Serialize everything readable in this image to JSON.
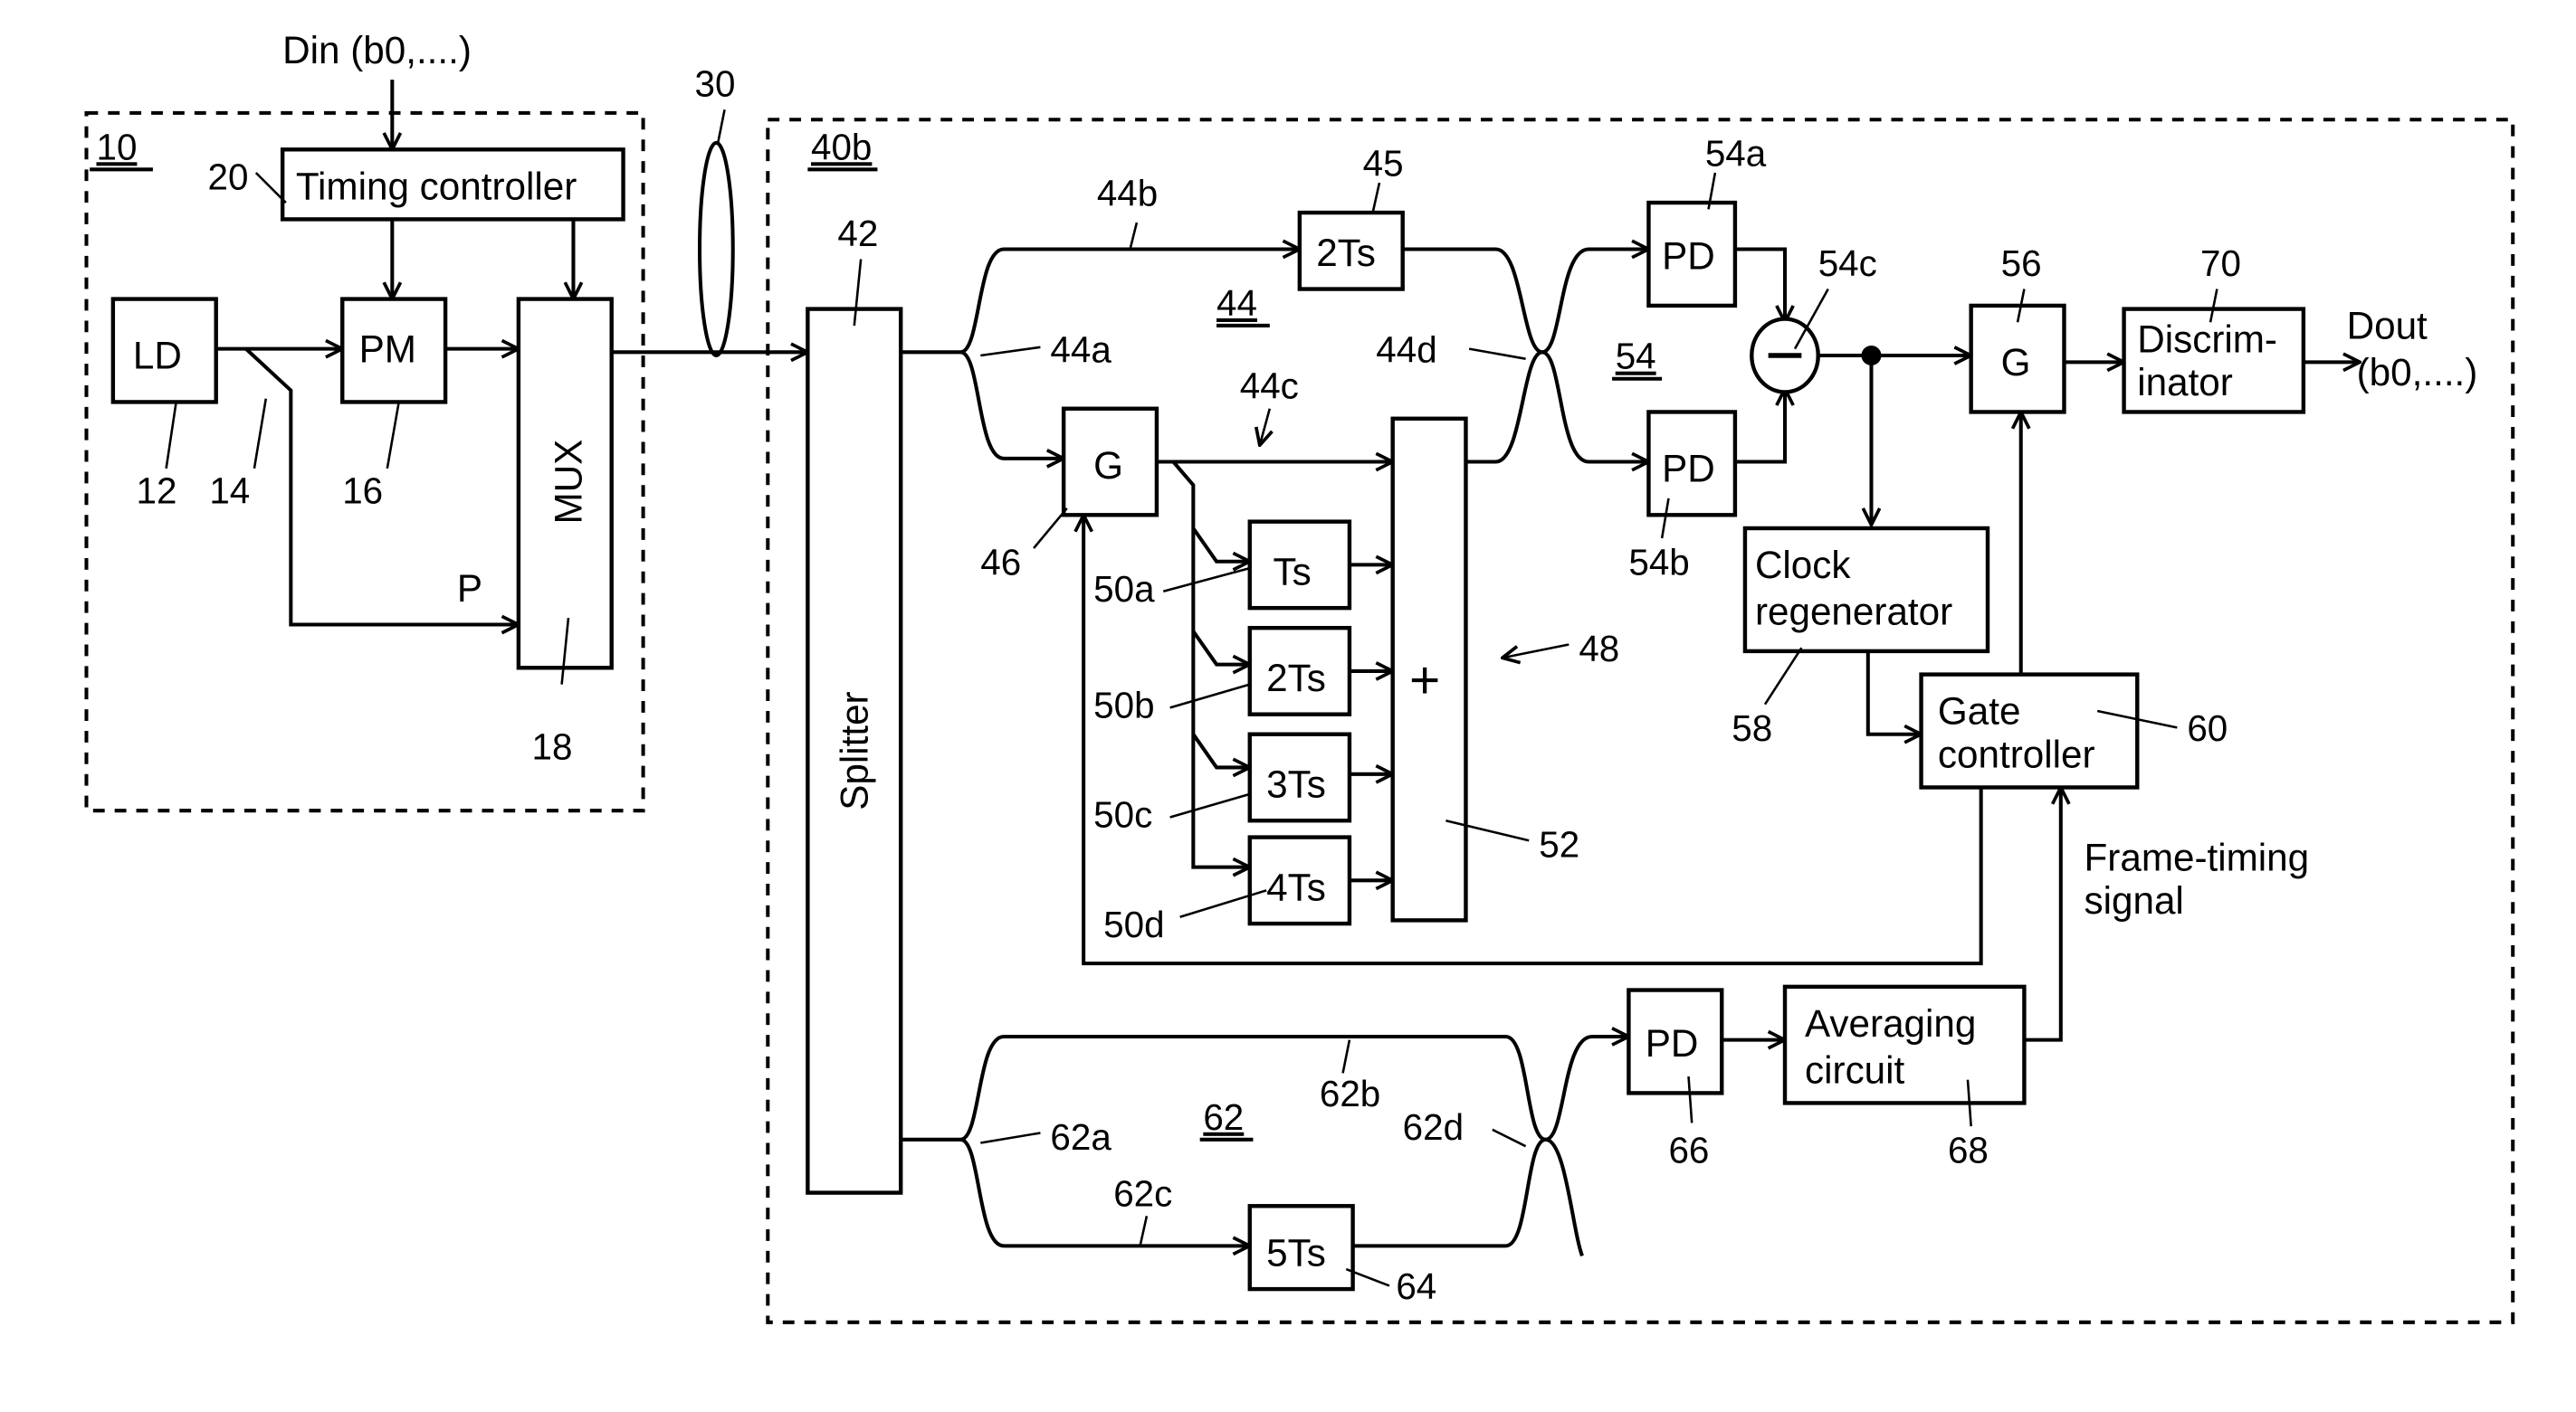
{
  "input_label": "Din (b0,....)",
  "output_label_line1": "Dout",
  "output_label_line2": "(b0,....)",
  "transmitter": {
    "ref": "10",
    "timing_controller": {
      "label": "Timing controller",
      "ref": "20"
    },
    "laser": {
      "label": "LD",
      "ref": "12"
    },
    "branch_ref": "14",
    "phase_modulator": {
      "label": "PM",
      "ref": "16"
    },
    "mux": {
      "label": "MUX",
      "ref": "18"
    },
    "pulse_label": "P"
  },
  "fiber_ref": "30",
  "receiver": {
    "ref": "40b",
    "splitter": {
      "label": "Splitter",
      "ref": "42"
    },
    "interferometer_44": {
      "ref": "44",
      "arm_refs": [
        "44a",
        "44b",
        "44c",
        "44d"
      ],
      "delay": {
        "label": "2Ts",
        "ref": "45"
      }
    },
    "gate_46": {
      "label": "G",
      "ref": "46"
    },
    "delay_bank": {
      "ref": "48",
      "delays": [
        {
          "label": "Ts",
          "ref": "50a"
        },
        {
          "label": "2Ts",
          "ref": "50b"
        },
        {
          "label": "3Ts",
          "ref": "50c"
        },
        {
          "label": "4Ts",
          "ref": "50d"
        }
      ],
      "combiner": {
        "label": "+",
        "ref": "52"
      }
    },
    "balanced_detector": {
      "ref": "54",
      "pd_top": {
        "label": "PD",
        "ref": "54a"
      },
      "pd_bottom": {
        "label": "PD",
        "ref": "54b"
      },
      "subtractor": {
        "label": "−",
        "ref": "54c"
      }
    },
    "gate_56": {
      "label": "G",
      "ref": "56"
    },
    "discriminator": {
      "label_line1": "Discrim-",
      "label_line2": "inator",
      "ref": "70"
    },
    "clock_regenerator": {
      "label_line1": "Clock",
      "label_line2": "regenerator",
      "ref": "58"
    },
    "gate_controller": {
      "label_line1": "Gate",
      "label_line2": "controller",
      "ref": "60"
    },
    "frame_timing_label_line1": "Frame-timing",
    "frame_timing_label_line2": "signal",
    "interferometer_62": {
      "ref": "62",
      "arm_refs": [
        "62a",
        "62b",
        "62c",
        "62d"
      ],
      "delay": {
        "label": "5Ts",
        "ref": "64"
      }
    },
    "pd_66": {
      "label": "PD",
      "ref": "66"
    },
    "averaging_circuit": {
      "label_line1": "Averaging",
      "label_line2": "circuit",
      "ref": "68"
    }
  }
}
